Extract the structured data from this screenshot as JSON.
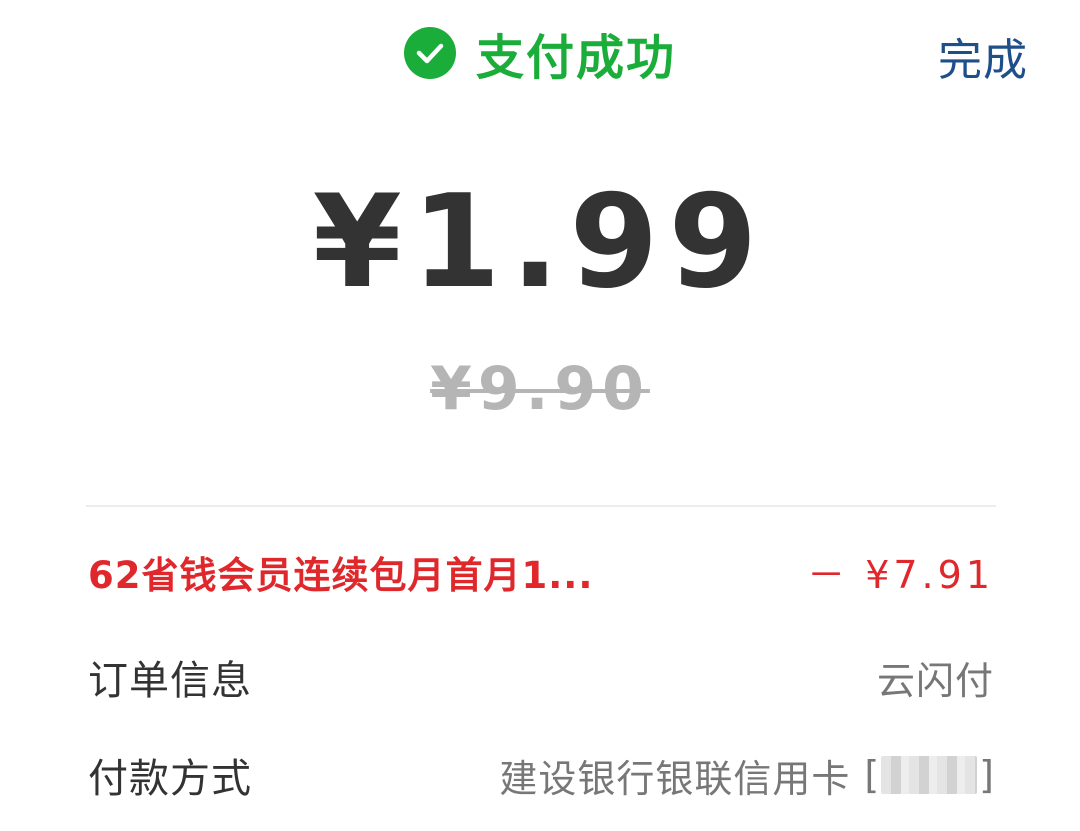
{
  "header": {
    "status_text": "支付成功",
    "done_label": "完成"
  },
  "payment": {
    "amount": "¥1.99",
    "original_amount": "¥9.90"
  },
  "details": {
    "discount": {
      "label": "62省钱会员连续包月首月1...",
      "value": "－ ¥7.91"
    },
    "order_info": {
      "label": "订单信息",
      "value": "云闪付"
    },
    "payment_method": {
      "label": "付款方式",
      "value": "建设银行银联信用卡",
      "bracket_open": "[",
      "bracket_close": "]"
    }
  },
  "colors": {
    "success_green": "#1aad3a",
    "link_blue": "#1e4f8a",
    "discount_red": "#e0282c",
    "amount_text": "#333333",
    "muted_text": "#777777"
  },
  "icons": {
    "status_icon": "check-circle-icon"
  }
}
